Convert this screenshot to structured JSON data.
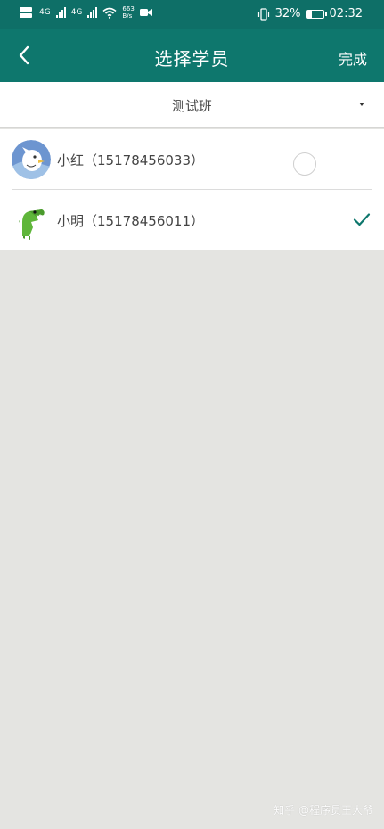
{
  "status_bar": {
    "network_speed_value": "663",
    "network_speed_unit": "B/s",
    "signal_1_label": "4G",
    "signal_2_label": "4G",
    "battery_percent": "32%",
    "battery_level": 0.32,
    "time": "02:32"
  },
  "header": {
    "title": "选择学员",
    "done_label": "完成",
    "back_icon": "chevron-left-icon"
  },
  "class_selector": {
    "selected": "测试班"
  },
  "students": [
    {
      "name": "小红",
      "phone": "（15178456033）",
      "selected": false
    },
    {
      "name": "小明",
      "phone": "（15178456011）",
      "selected": true
    }
  ],
  "watermark": "知乎 @程序员王大爷",
  "colors": {
    "primary": "#0e776d",
    "status_bar": "#0e6f67",
    "check": "#0e776d",
    "background": "#e4e4e1"
  }
}
